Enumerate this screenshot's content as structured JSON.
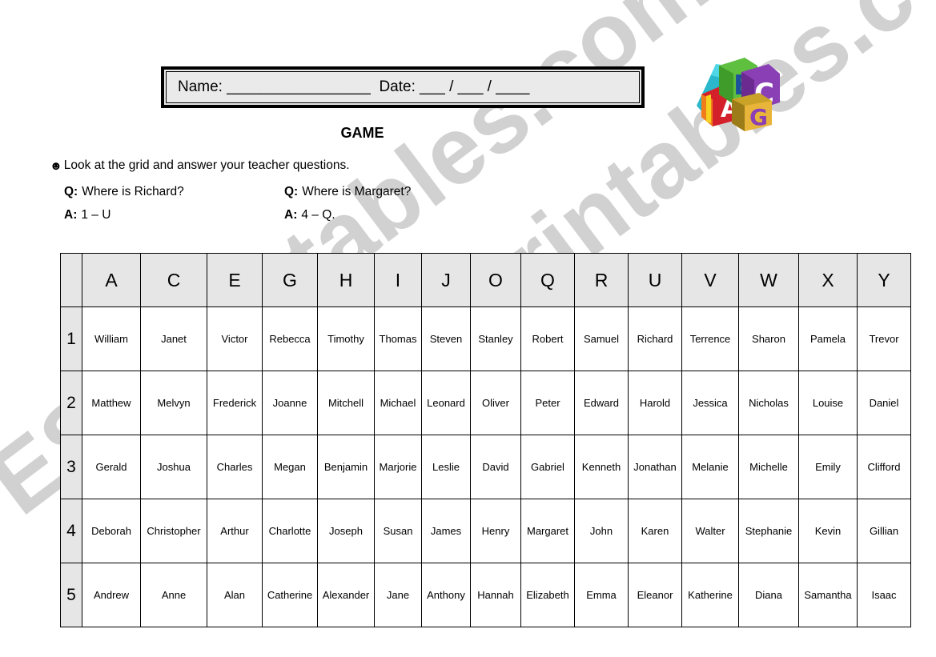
{
  "header": {
    "name_label": "Name: _________________",
    "date_label": "Date: ___ / ___ / ____",
    "logo_alt": "abc-blocks-logo"
  },
  "title": "GAME",
  "instructions": {
    "bullet": "☻",
    "text": "Look at the grid and answer your teacher questions."
  },
  "examples": [
    {
      "q_label": "Q:",
      "q_text": "Where is Richard?",
      "a_label": "A:",
      "a_text": "1 – U"
    },
    {
      "q_label": "Q:",
      "q_text": "Where is Margaret?",
      "a_label": "A:",
      "a_text": "4 – Q."
    }
  ],
  "watermark": {
    "line1": "ESLprintables.com",
    "line2": "ESLprintables.com"
  },
  "grid": {
    "corner": "",
    "columns": [
      "A",
      "C",
      "E",
      "G",
      "H",
      "I",
      "J",
      "O",
      "Q",
      "R",
      "U",
      "V",
      "W",
      "X",
      "Y"
    ],
    "rows": [
      {
        "label": "1",
        "cells": [
          "William",
          "Janet",
          "Victor",
          "Rebecca",
          "Timothy",
          "Thomas",
          "Steven",
          "Stanley",
          "Robert",
          "Samuel",
          "Richard",
          "Terrence",
          "Sharon",
          "Pamela",
          "Trevor"
        ]
      },
      {
        "label": "2",
        "cells": [
          "Matthew",
          "Melvyn",
          "Frederick",
          "Joanne",
          "Mitchell",
          "Michael",
          "Leonard",
          "Oliver",
          "Peter",
          "Edward",
          "Harold",
          "Jessica",
          "Nicholas",
          "Louise",
          "Daniel"
        ]
      },
      {
        "label": "3",
        "cells": [
          "Gerald",
          "Joshua",
          "Charles",
          "Megan",
          "Benjamin",
          "Marjorie",
          "Leslie",
          "David",
          "Gabriel",
          "Kenneth",
          "Jonathan",
          "Melanie",
          "Michelle",
          "Emily",
          "Clifford"
        ]
      },
      {
        "label": "4",
        "cells": [
          "Deborah",
          "Christopher",
          "Arthur",
          "Charlotte",
          "Joseph",
          "Susan",
          "James",
          "Henry",
          "Margaret",
          "John",
          "Karen",
          "Walter",
          "Stephanie",
          "Kevin",
          "Gillian"
        ]
      },
      {
        "label": "5",
        "cells": [
          "Andrew",
          "Anne",
          "Alan",
          "Catherine",
          "Alexander",
          "Jane",
          "Anthony",
          "Hannah",
          "Elizabeth",
          "Emma",
          "Eleanor",
          "Katherine",
          "Diana",
          "Samantha",
          "Isaac"
        ]
      }
    ]
  },
  "colors": {
    "header_fill": "#e6e6e6",
    "namebox_fill": "#eaeaea",
    "border": "#000000",
    "watermark": "#c9c9c9"
  }
}
